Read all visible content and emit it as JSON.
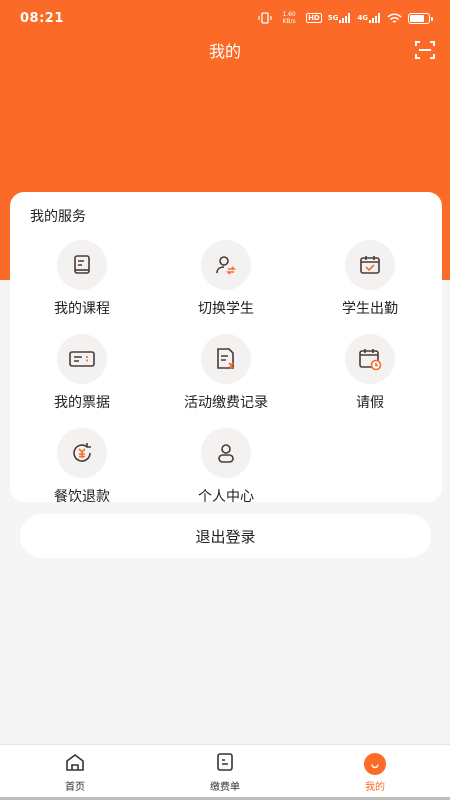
{
  "status_bar": {
    "time": "08:21",
    "net_speed": "1.60 KB/s",
    "hd": "HD",
    "signal_5g": "5G",
    "signal_4g": "4G"
  },
  "header": {
    "title": "我的",
    "scan_icon": "scan-icon",
    "color": "#fb6a26"
  },
  "services": {
    "title": "我的服务",
    "items": [
      {
        "label": "我的课程",
        "icon": "book-icon"
      },
      {
        "label": "切换学生",
        "icon": "switch-student-icon"
      },
      {
        "label": "学生出勤",
        "icon": "attendance-calendar-icon"
      },
      {
        "label": "我的票据",
        "icon": "ticket-icon"
      },
      {
        "label": "活动缴费记录",
        "icon": "payment-record-icon"
      },
      {
        "label": "请假",
        "icon": "leave-calendar-icon"
      },
      {
        "label": "餐饮退款",
        "icon": "refund-icon"
      },
      {
        "label": "个人中心",
        "icon": "person-icon"
      }
    ]
  },
  "logout": {
    "label": "退出登录"
  },
  "bottom_nav": {
    "items": [
      {
        "label": "首页",
        "icon": "home-icon"
      },
      {
        "label": "缴费单",
        "icon": "bill-icon"
      },
      {
        "label": "我的",
        "icon": "profile-icon",
        "active": true
      }
    ]
  }
}
